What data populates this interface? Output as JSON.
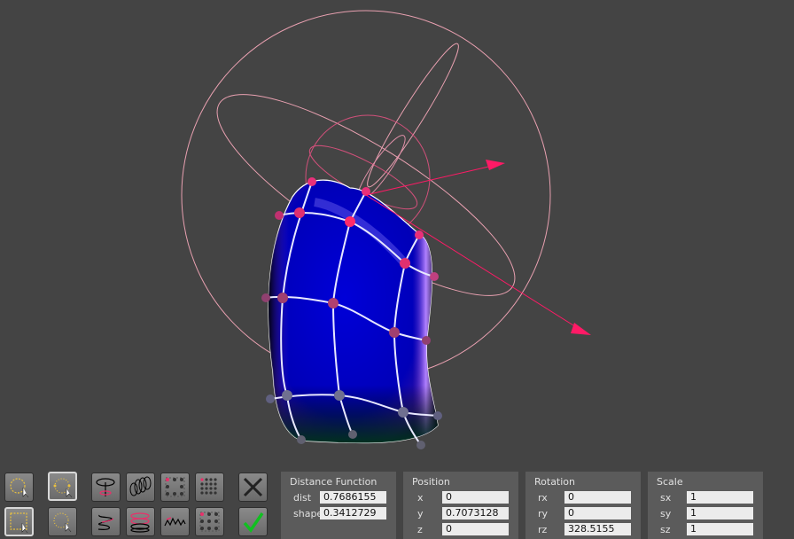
{
  "viewport": {
    "background": "#444444",
    "gizmo_color": "#e8a0b0",
    "axis_color": "#ff1a66",
    "surface_color": "#0000c8",
    "control_point_color": "#e0306a"
  },
  "toolbar": {
    "buttons": [
      {
        "icon": "lasso-select-icon"
      },
      {
        "icon": "lasso-select-dotted-icon"
      },
      {
        "icon": "extrude-profile-icon"
      },
      {
        "icon": "twist-deform-icon"
      },
      {
        "icon": "grid-points-icon"
      },
      {
        "icon": "dense-grid-icon"
      },
      {
        "icon": "cancel-x-icon"
      },
      {
        "icon": "rect-select-icon"
      },
      {
        "icon": "rect-select-dotted-icon"
      },
      {
        "icon": "spiral-path-icon"
      },
      {
        "icon": "ring-stack-icon"
      },
      {
        "icon": "noise-deform-icon"
      },
      {
        "icon": "grid-corner-icon"
      },
      {
        "icon": "accept-check-icon"
      }
    ]
  },
  "panels": {
    "distance": {
      "title": "Distance Function",
      "fields": [
        {
          "label": "dist",
          "value": "0.7686155"
        },
        {
          "label": "shape",
          "value": "0.3412729"
        }
      ]
    },
    "position": {
      "title": "Position",
      "fields": [
        {
          "label": "x",
          "value": "0"
        },
        {
          "label": "y",
          "value": "0.7073128"
        },
        {
          "label": "z",
          "value": "0"
        }
      ]
    },
    "rotation": {
      "title": "Rotation",
      "fields": [
        {
          "label": "rx",
          "value": "0"
        },
        {
          "label": "ry",
          "value": "0"
        },
        {
          "label": "rz",
          "value": "328.5155"
        }
      ]
    },
    "scale": {
      "title": "Scale",
      "fields": [
        {
          "label": "sx",
          "value": "1"
        },
        {
          "label": "sy",
          "value": "1"
        },
        {
          "label": "sz",
          "value": "1"
        }
      ]
    }
  }
}
